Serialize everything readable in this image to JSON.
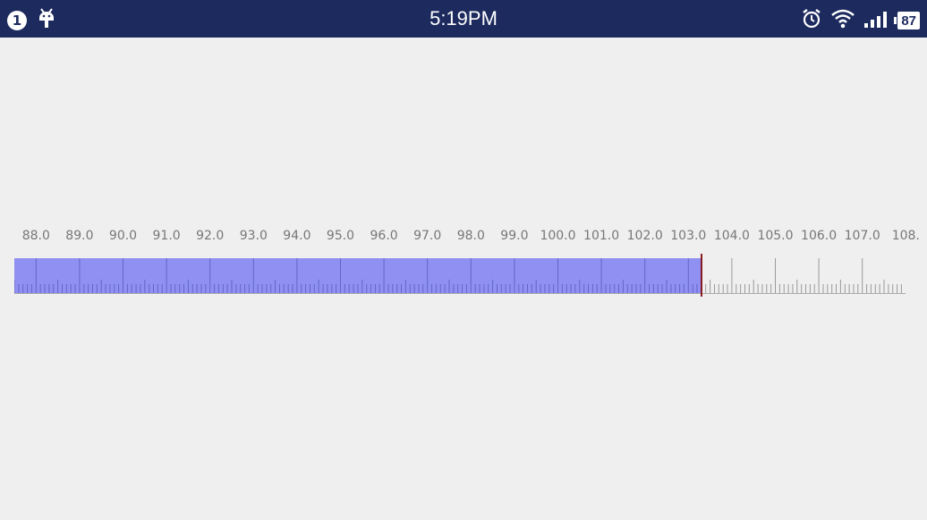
{
  "status_bar": {
    "notification_count": "1",
    "time": "5:19PM",
    "battery": "87",
    "icons": [
      "notification-badge",
      "android-debug-icon",
      "alarm-icon",
      "wifi-icon",
      "signal-icon",
      "battery-icon"
    ]
  },
  "ruler": {
    "labels": [
      "88.0",
      "89.0",
      "90.0",
      "91.0",
      "92.0",
      "93.0",
      "94.0",
      "95.0",
      "96.0",
      "97.0",
      "98.0",
      "99.0",
      "100.0",
      "101.0",
      "102.0",
      "103.0",
      "104.0",
      "105.0",
      "106.0",
      "107.0",
      "108."
    ],
    "min_value": 87.5,
    "selected_value": 103.3,
    "max_value": 108.0,
    "major_step": 1.0,
    "minor_step": 0.1,
    "fill_color": "#8f90f2",
    "indicator_color": "#8a1b22",
    "tick_color": "#999999"
  }
}
